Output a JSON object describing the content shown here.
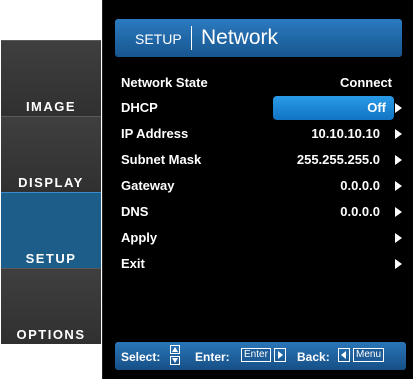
{
  "tabs": [
    {
      "label": "IMAGE",
      "active": false
    },
    {
      "label": "DISPLAY",
      "active": false
    },
    {
      "label": "SETUP",
      "active": true
    },
    {
      "label": "OPTIONS",
      "active": false
    }
  ],
  "header": {
    "section": "SETUP",
    "title": "Network"
  },
  "rows": [
    {
      "label": "Network State",
      "value": "Connect",
      "arrow": false,
      "selected": false
    },
    {
      "label": "DHCP",
      "value": "Off",
      "arrow": true,
      "selected": true
    },
    {
      "label": "IP Address",
      "value": "10.10.10.10",
      "arrow": true,
      "selected": false
    },
    {
      "label": "Subnet Mask",
      "value": "255.255.255.0",
      "arrow": true,
      "selected": false
    },
    {
      "label": "Gateway",
      "value": "0.0.0.0",
      "arrow": true,
      "selected": false
    },
    {
      "label": "DNS",
      "value": "0.0.0.0",
      "arrow": true,
      "selected": false
    },
    {
      "label": "Apply",
      "value": "",
      "arrow": true,
      "selected": false
    },
    {
      "label": "Exit",
      "value": "",
      "arrow": true,
      "selected": false
    }
  ],
  "footer": {
    "select_label": "Select:",
    "enter_label": "Enter:",
    "enter_key": "Enter",
    "back_label": "Back:",
    "menu_key": "Menu"
  },
  "colors": {
    "accent": "#1c6fb5",
    "highlight": "#2a9be8",
    "panel_bg": "#000000"
  }
}
